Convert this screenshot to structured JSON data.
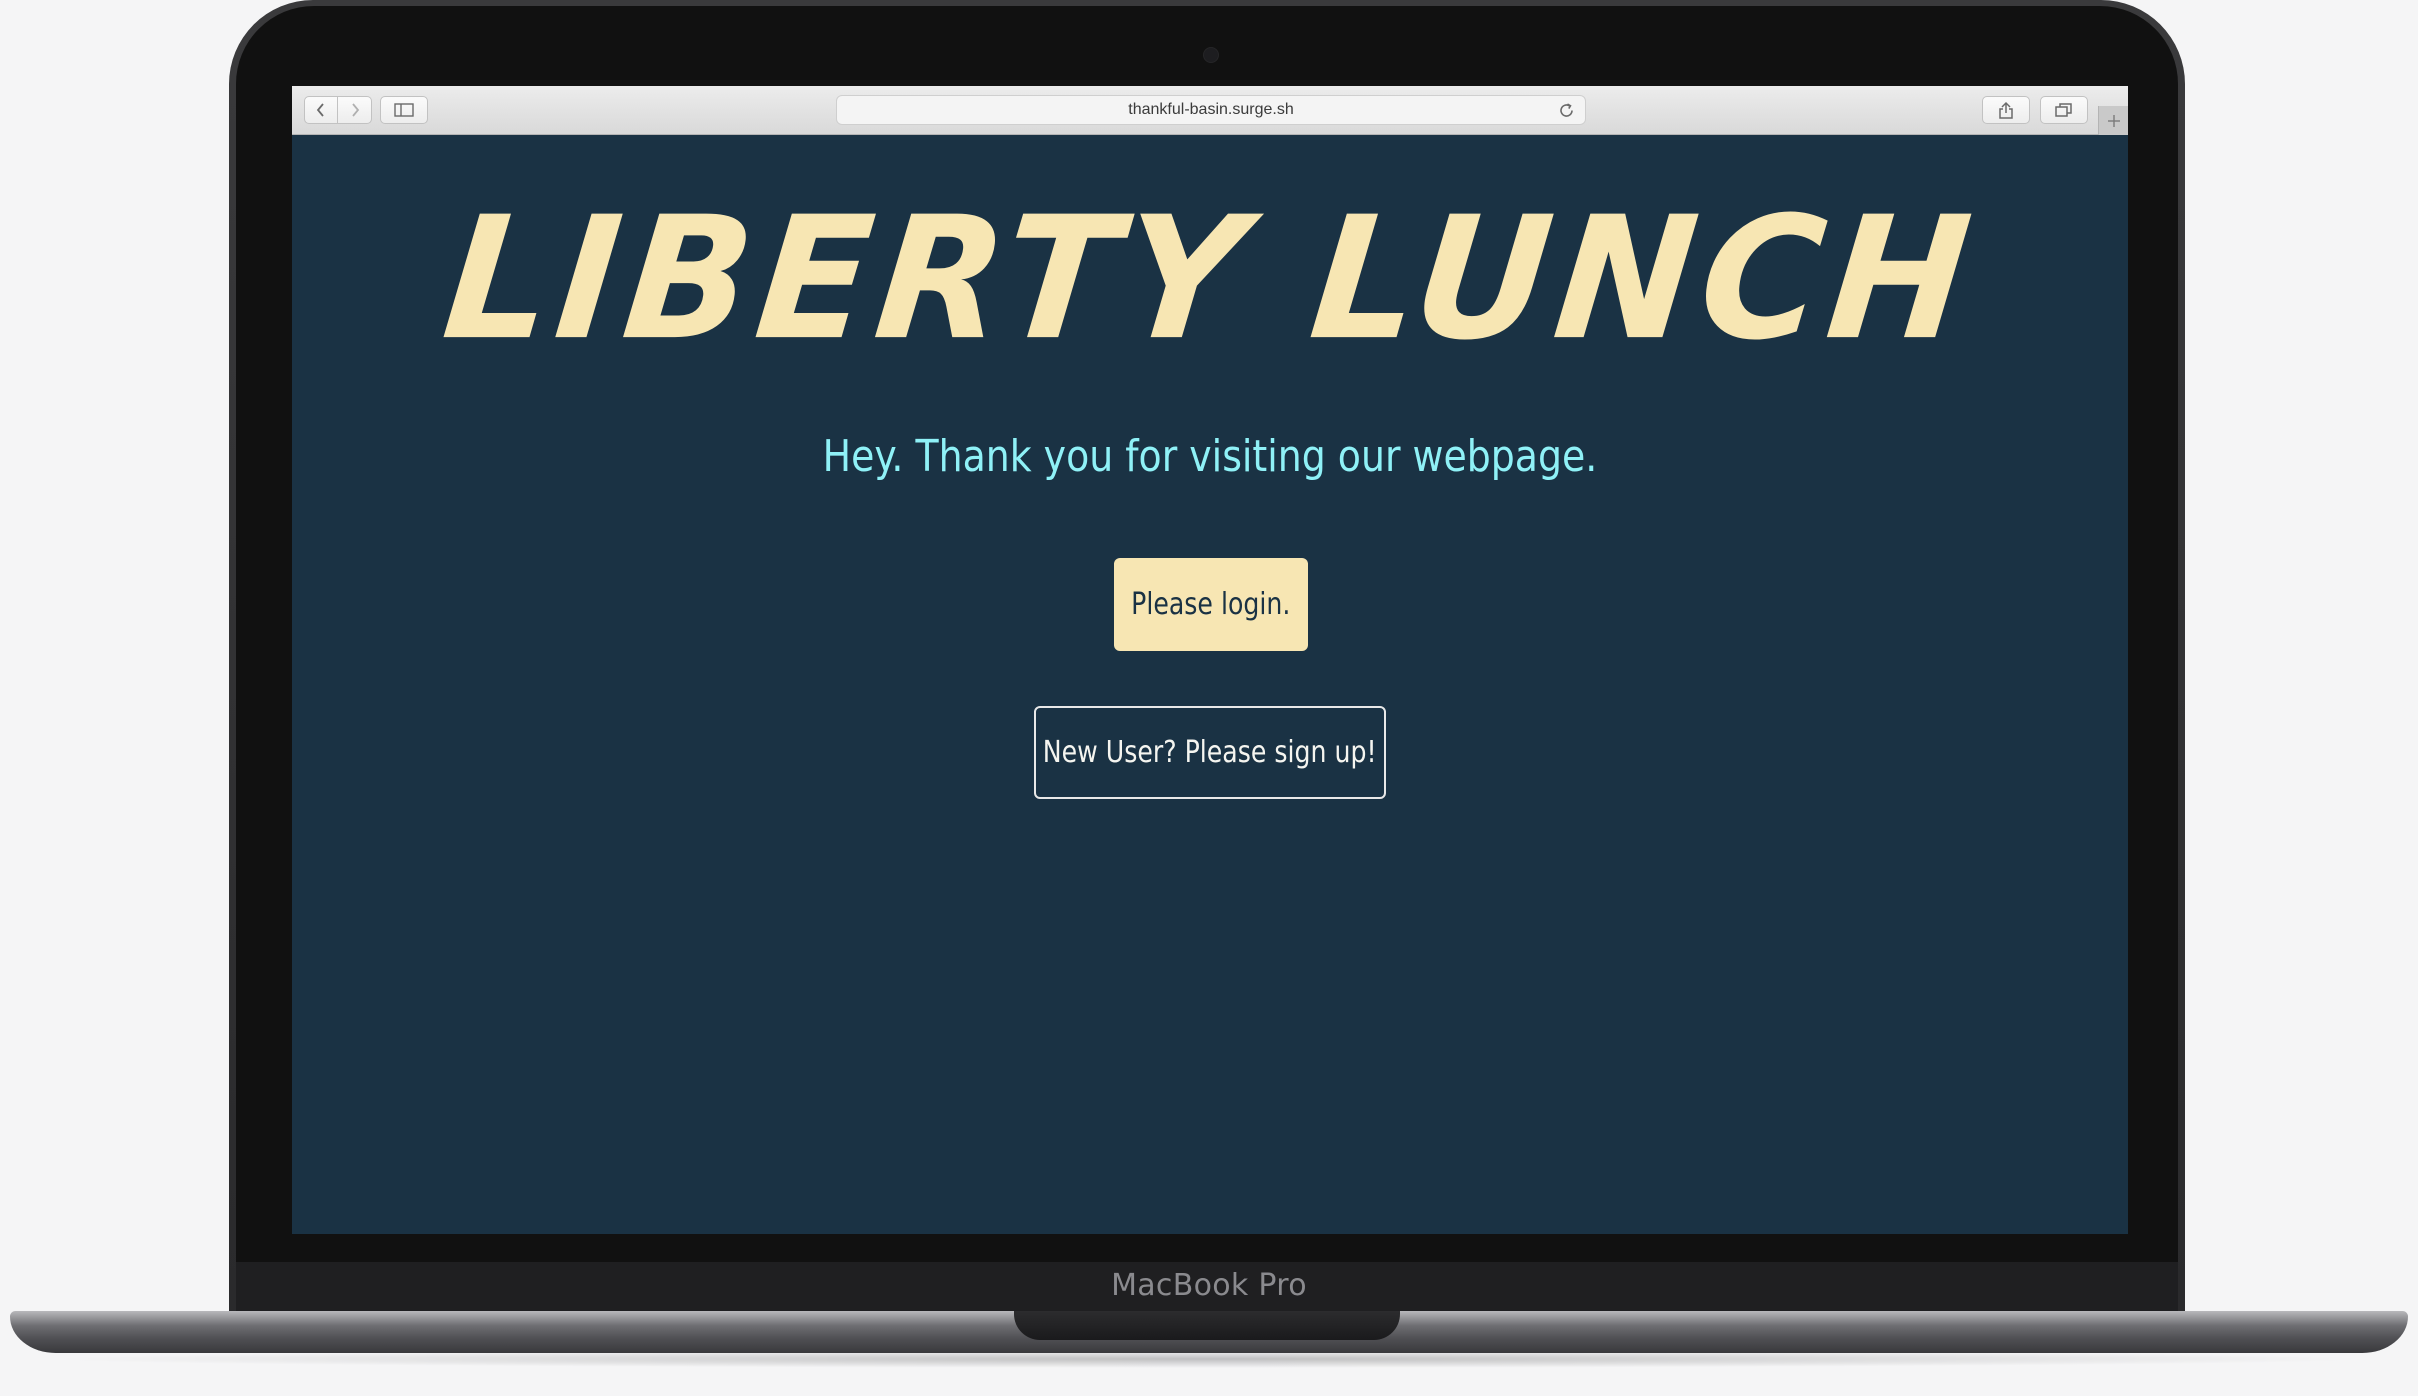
{
  "device": {
    "label": "MacBook Pro"
  },
  "browser": {
    "url": "thankful-basin.surge.sh",
    "icons": [
      "back-icon",
      "forward-icon",
      "sidebar-icon",
      "reload-icon",
      "share-icon",
      "tabs-icon",
      "new-tab-icon"
    ]
  },
  "page": {
    "title": "LIBERTY LUNCH",
    "tagline": "Hey. Thank you for visiting our webpage.",
    "login_label": "Please login.",
    "signup_label": "New User? Please sign up!"
  },
  "colors": {
    "background": "#1a3244",
    "title": "#f7e6b3",
    "tagline": "#8ff1f7",
    "login_button_bg": "#f7e6b3",
    "signup_border": "#e8e8e8"
  }
}
